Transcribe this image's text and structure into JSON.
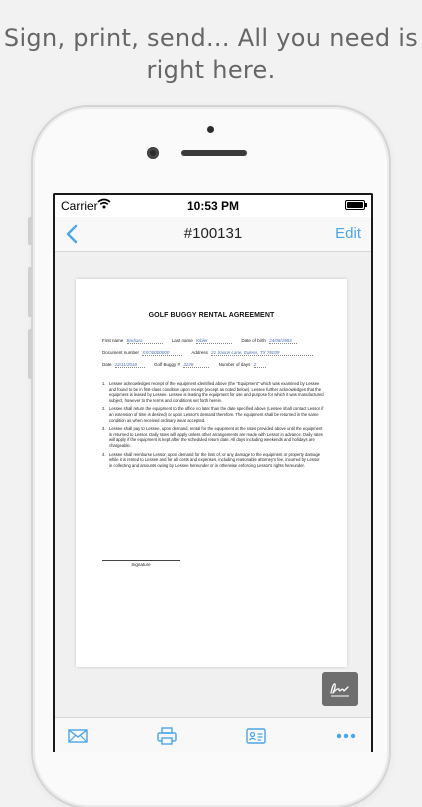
{
  "tagline": {
    "line1": "Sign, print, send... All you need is",
    "line2": "right here."
  },
  "status_bar": {
    "carrier": "Carrier",
    "time": "10:53 PM"
  },
  "nav": {
    "title": "#100131",
    "edit_label": "Edit"
  },
  "document": {
    "title": "GOLF BUGGY RENTAL AGREEMENT",
    "fields": {
      "first_name_label": "First name",
      "first_name_value": "Barbara",
      "last_name_label": "Last name",
      "last_name_value": "Kibler",
      "dob_label": "Date of birth",
      "dob_value": "24/08/1983",
      "doc_number_label": "Document number",
      "doc_number_value": "XXO0000000",
      "address_label": "Address",
      "address_value": "21 Saxon Lane, Euless, TX 76039",
      "date_label": "Date",
      "date_value": "22/11/2018",
      "buggy_label": "Golf Buggy #",
      "buggy_value": "3226",
      "days_label": "Number of days",
      "days_value": "2"
    },
    "clauses": [
      {
        "num": "1.",
        "text": "Lessee acknowledges receipt of the equipment identified above (the \"Equipment\" which was examined by Lessee and found to be in first-class condition upon receipt (except as noted below). Lessee further acknowledges that the equipment is leased by Lessee. Lessee is leasing the equipment for use and purpose for which it was manufactured subject, however to the terms and conditions set forth herein."
      },
      {
        "num": "2.",
        "text": "Lessee shall return the equipment to the office no later than the date specified above (Lessee shall contact Lessor if an extension of time is desired) or upon Lessor's demand therefore. The equipment shall be returned in the same condition as when received ordinary wear accepted."
      },
      {
        "num": "3.",
        "text": "Lessee shall pay to Lessee, upon demand, rental for the equipment at the rates provided above until the equipment is returned to Lessor. Daily rates will apply unless other arrangements are made with Lessor in advance. Daily rates will apply if the equipment is kept after the scheduled return date. All days including weekends and holidays are chargeable."
      },
      {
        "num": "4.",
        "text": "Lessee shall reimburse Lessor, upon demand for the loss of, or any damage to the equipment or property damage while it is rented to Lessee and for all costs and expenses, including reasonable attorney's fee, incurred by Lessor in collecting and amounts owing by Lessee hereunder or in otherwise enforcing Lessor's rights hereunder."
      }
    ],
    "signature_label": "Signature"
  },
  "toolbar": {
    "icons": [
      "envelope-icon",
      "printer-icon",
      "contact-card-icon",
      "more-icon"
    ]
  },
  "colors": {
    "accent": "#4aa6e8",
    "field_value": "#4a6fb5",
    "sign_button": "#6e6e6e"
  }
}
